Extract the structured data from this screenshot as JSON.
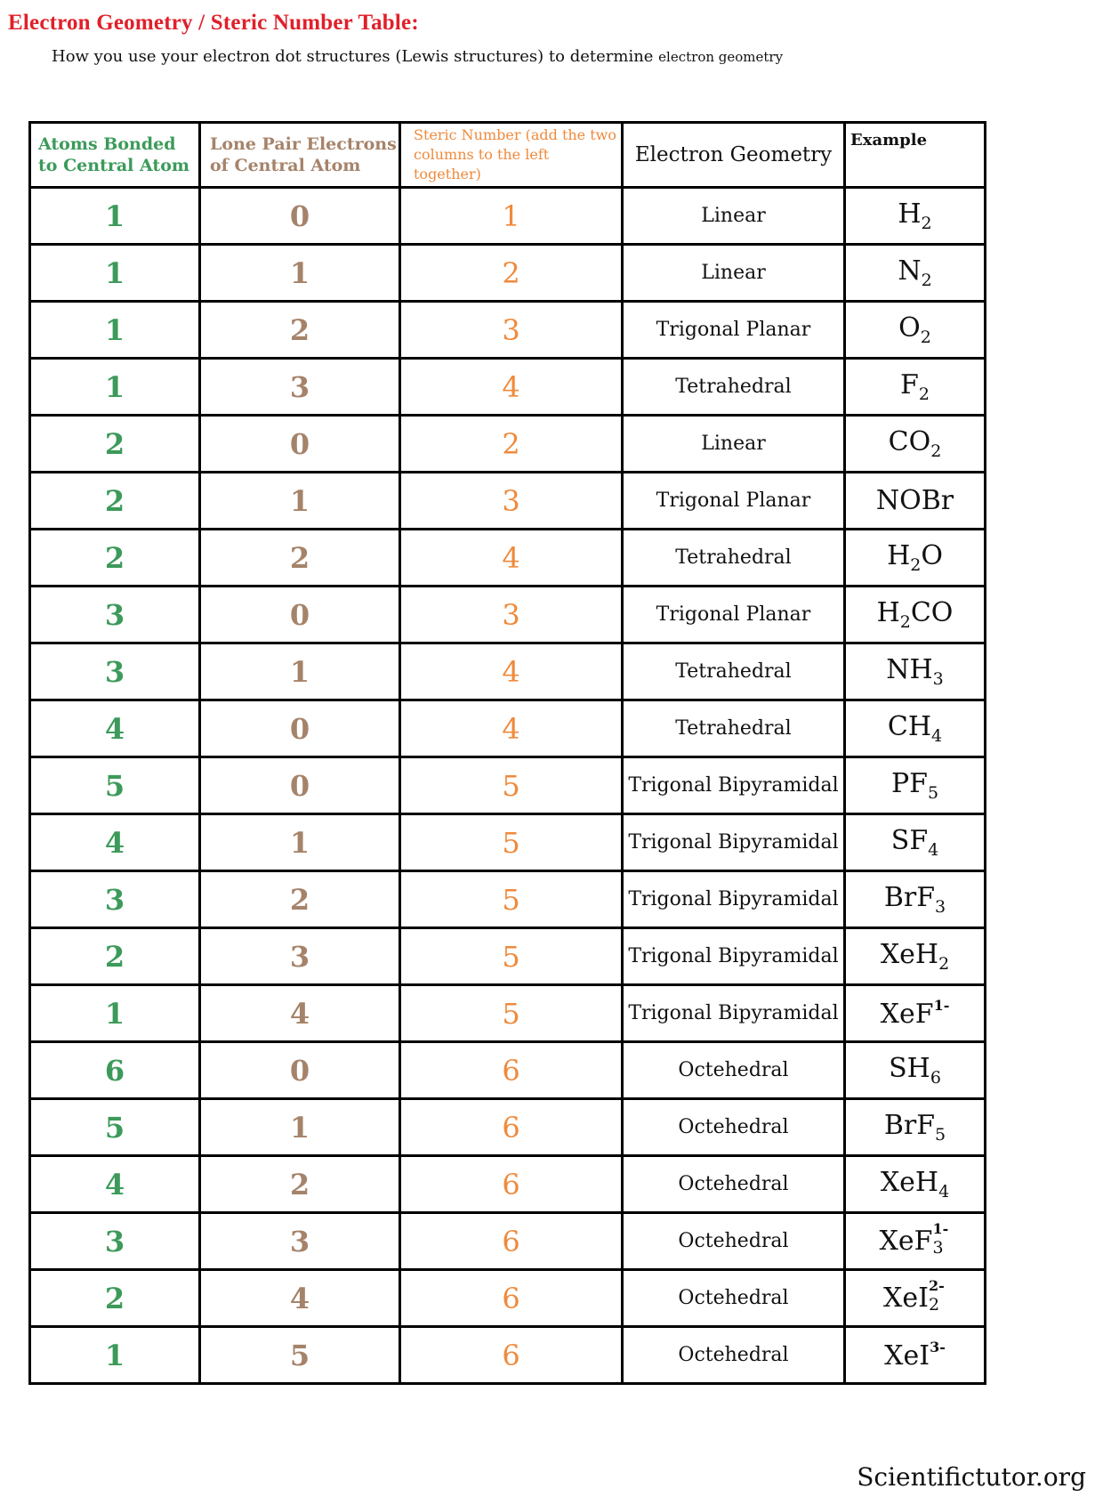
{
  "title": "Electron Geometry / Steric Number Table:",
  "subtitle": {
    "main": "How you use your electron dot structures (Lewis structures) to determine ",
    "small": "electron geometry"
  },
  "colors": {
    "title": "#e0202a",
    "atoms_bonded": "#3c9a5a",
    "lone_pairs": "#a5836a",
    "steric_number": "#ef8a3c",
    "text": "#111111"
  },
  "table": {
    "headers": [
      "Atoms Bonded to Central Atom",
      "Lone Pair Electrons of Central Atom",
      "Steric Number (add the two columns to the left together)",
      "Electron Geometry",
      "Example"
    ],
    "rows": [
      {
        "bonded": "1",
        "lone": "0",
        "steric": "1",
        "geometry": "Linear",
        "ex": {
          "base": "H",
          "sub": "2",
          "sup": ""
        }
      },
      {
        "bonded": "1",
        "lone": "1",
        "steric": "2",
        "geometry": "Linear",
        "ex": {
          "base": "N",
          "sub": "2",
          "sup": ""
        }
      },
      {
        "bonded": "1",
        "lone": "2",
        "steric": "3",
        "geometry": "Trigonal Planar",
        "ex": {
          "base": "O",
          "sub": "2",
          "sup": ""
        }
      },
      {
        "bonded": "1",
        "lone": "3",
        "steric": "4",
        "geometry": "Tetrahedral",
        "ex": {
          "base": "F",
          "sub": "2",
          "sup": ""
        }
      },
      {
        "bonded": "2",
        "lone": "0",
        "steric": "2",
        "geometry": "Linear",
        "ex": {
          "base": "CO",
          "sub": "2",
          "sup": ""
        }
      },
      {
        "bonded": "2",
        "lone": "1",
        "steric": "3",
        "geometry": "Trigonal Planar",
        "ex": {
          "base": "NOBr",
          "sub": "",
          "sup": ""
        }
      },
      {
        "bonded": "2",
        "lone": "2",
        "steric": "4",
        "geometry": "Tetrahedral",
        "ex": {
          "base": "H",
          "sub": "2",
          "tail": "O",
          "sup": ""
        }
      },
      {
        "bonded": "3",
        "lone": "0",
        "steric": "3",
        "geometry": "Trigonal Planar",
        "ex": {
          "base": "H",
          "sub": "2",
          "tail": "CO",
          "sup": ""
        }
      },
      {
        "bonded": "3",
        "lone": "1",
        "steric": "4",
        "geometry": "Tetrahedral",
        "ex": {
          "base": "NH",
          "sub": "3",
          "sup": ""
        }
      },
      {
        "bonded": "4",
        "lone": "0",
        "steric": "4",
        "geometry": "Tetrahedral",
        "ex": {
          "base": "CH",
          "sub": "4",
          "sup": ""
        }
      },
      {
        "bonded": "5",
        "lone": "0",
        "steric": "5",
        "geometry": "Trigonal Bipyramidal",
        "ex": {
          "base": "PF",
          "sub": "5",
          "sup": ""
        }
      },
      {
        "bonded": "4",
        "lone": "1",
        "steric": "5",
        "geometry": "Trigonal Bipyramidal",
        "ex": {
          "base": "SF",
          "sub": "4",
          "sup": ""
        }
      },
      {
        "bonded": "3",
        "lone": "2",
        "steric": "5",
        "geometry": "Trigonal Bipyramidal",
        "ex": {
          "base": "BrF",
          "sub": "3",
          "sup": ""
        }
      },
      {
        "bonded": "2",
        "lone": "3",
        "steric": "5",
        "geometry": "Trigonal Bipyramidal",
        "ex": {
          "base": "XeH",
          "sub": "2",
          "sup": ""
        }
      },
      {
        "bonded": "1",
        "lone": "4",
        "steric": "5",
        "geometry": "Trigonal Bipyramidal",
        "ex": {
          "base": "XeF",
          "sub": "",
          "sup": "1-"
        }
      },
      {
        "bonded": "6",
        "lone": "0",
        "steric": "6",
        "geometry": "Octehedral",
        "ex": {
          "base": "SH",
          "sub": "6",
          "sup": ""
        }
      },
      {
        "bonded": "5",
        "lone": "1",
        "steric": "6",
        "geometry": "Octehedral",
        "ex": {
          "base": "BrF",
          "sub": "5",
          "sup": ""
        }
      },
      {
        "bonded": "4",
        "lone": "2",
        "steric": "6",
        "geometry": "Octehedral",
        "ex": {
          "base": "XeH",
          "sub": "4",
          "sup": ""
        }
      },
      {
        "bonded": "3",
        "lone": "3",
        "steric": "6",
        "geometry": "Octehedral",
        "ex": {
          "base": "XeF",
          "sub": "3",
          "sup": "1-"
        }
      },
      {
        "bonded": "2",
        "lone": "4",
        "steric": "6",
        "geometry": "Octehedral",
        "ex": {
          "base": "XeI",
          "sub": "2",
          "sup": "2-"
        }
      },
      {
        "bonded": "1",
        "lone": "5",
        "steric": "6",
        "geometry": "Octehedral",
        "ex": {
          "base": "XeI",
          "sub": "",
          "sup": "3-"
        }
      }
    ]
  },
  "footer": "Scientifictutor.org"
}
